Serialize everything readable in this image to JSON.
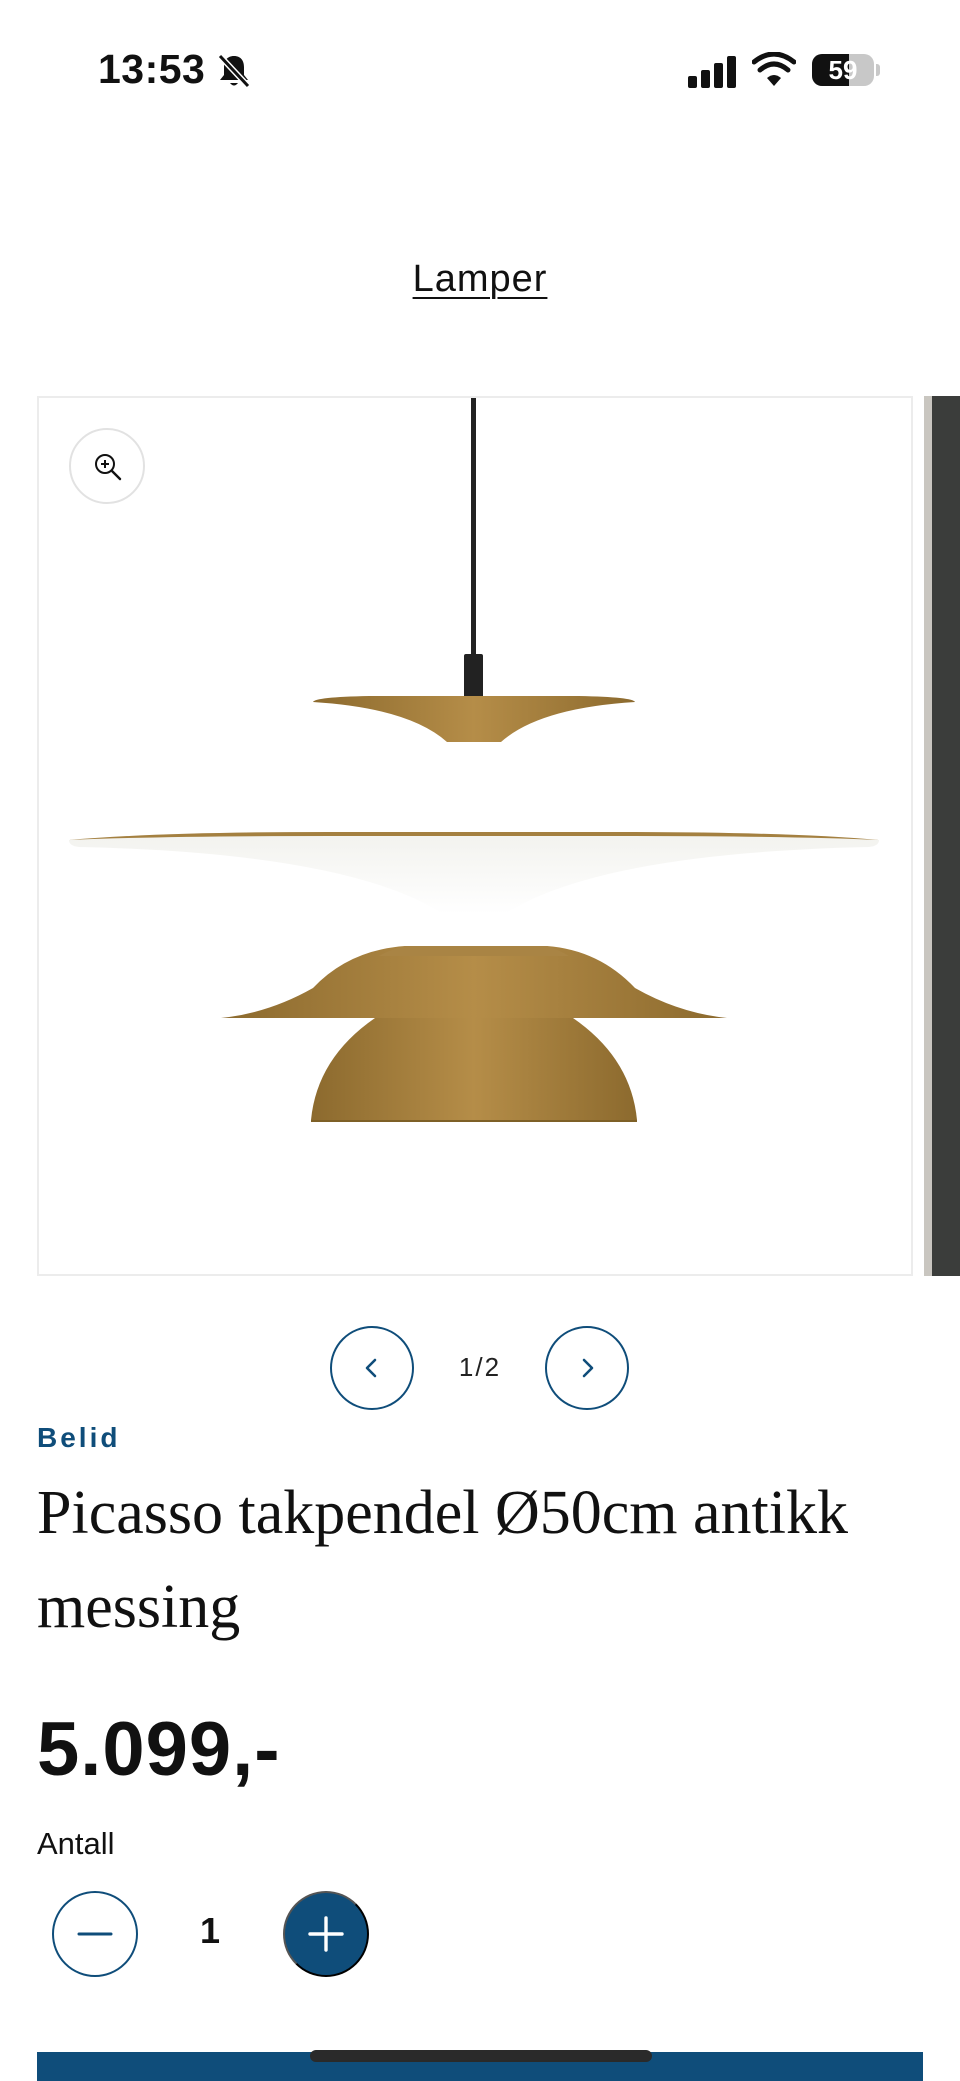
{
  "status_bar": {
    "time": "13:53",
    "battery": "59",
    "battery_level": 0.59
  },
  "breadcrumb": {
    "label": "Lamper"
  },
  "gallery": {
    "current": "1/2"
  },
  "product": {
    "brand": "Belid",
    "title": "Picasso takpendel Ø50cm antikk messing",
    "price": "5.099,-",
    "quantity_label": "Antall",
    "quantity": "1"
  },
  "colors": {
    "accent": "#0f4d7a",
    "brass": "#9e7838"
  },
  "icons": {
    "status": [
      "bell-slash-icon",
      "signal-icon",
      "wifi-icon",
      "battery-icon"
    ],
    "gallery": [
      "zoom-in-icon",
      "chevron-left-icon",
      "chevron-right-icon"
    ],
    "quantity": [
      "minus-icon",
      "plus-icon"
    ]
  }
}
